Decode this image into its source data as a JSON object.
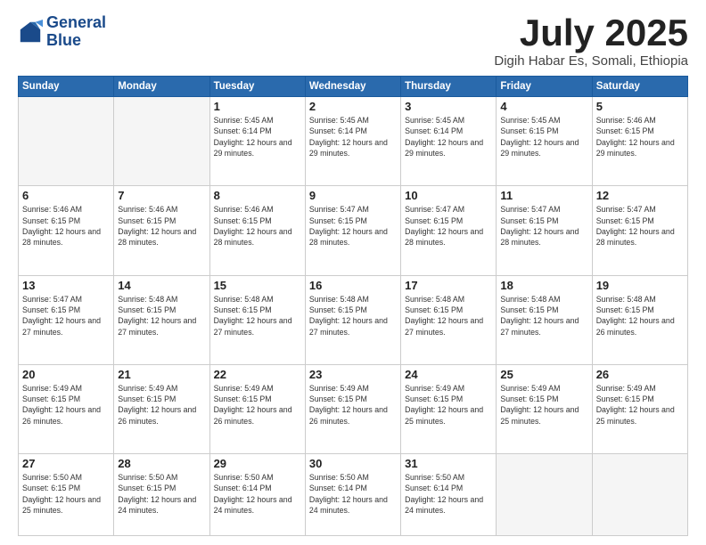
{
  "header": {
    "logo_line1": "General",
    "logo_line2": "Blue",
    "month_title": "July 2025",
    "subtitle": "Digih Habar Es, Somali, Ethiopia"
  },
  "weekdays": [
    "Sunday",
    "Monday",
    "Tuesday",
    "Wednesday",
    "Thursday",
    "Friday",
    "Saturday"
  ],
  "weeks": [
    [
      {
        "day": "",
        "info": ""
      },
      {
        "day": "",
        "info": ""
      },
      {
        "day": "1",
        "info": "Sunrise: 5:45 AM\nSunset: 6:14 PM\nDaylight: 12 hours and 29 minutes."
      },
      {
        "day": "2",
        "info": "Sunrise: 5:45 AM\nSunset: 6:14 PM\nDaylight: 12 hours and 29 minutes."
      },
      {
        "day": "3",
        "info": "Sunrise: 5:45 AM\nSunset: 6:14 PM\nDaylight: 12 hours and 29 minutes."
      },
      {
        "day": "4",
        "info": "Sunrise: 5:45 AM\nSunset: 6:15 PM\nDaylight: 12 hours and 29 minutes."
      },
      {
        "day": "5",
        "info": "Sunrise: 5:46 AM\nSunset: 6:15 PM\nDaylight: 12 hours and 29 minutes."
      }
    ],
    [
      {
        "day": "6",
        "info": "Sunrise: 5:46 AM\nSunset: 6:15 PM\nDaylight: 12 hours and 28 minutes."
      },
      {
        "day": "7",
        "info": "Sunrise: 5:46 AM\nSunset: 6:15 PM\nDaylight: 12 hours and 28 minutes."
      },
      {
        "day": "8",
        "info": "Sunrise: 5:46 AM\nSunset: 6:15 PM\nDaylight: 12 hours and 28 minutes."
      },
      {
        "day": "9",
        "info": "Sunrise: 5:47 AM\nSunset: 6:15 PM\nDaylight: 12 hours and 28 minutes."
      },
      {
        "day": "10",
        "info": "Sunrise: 5:47 AM\nSunset: 6:15 PM\nDaylight: 12 hours and 28 minutes."
      },
      {
        "day": "11",
        "info": "Sunrise: 5:47 AM\nSunset: 6:15 PM\nDaylight: 12 hours and 28 minutes."
      },
      {
        "day": "12",
        "info": "Sunrise: 5:47 AM\nSunset: 6:15 PM\nDaylight: 12 hours and 28 minutes."
      }
    ],
    [
      {
        "day": "13",
        "info": "Sunrise: 5:47 AM\nSunset: 6:15 PM\nDaylight: 12 hours and 27 minutes."
      },
      {
        "day": "14",
        "info": "Sunrise: 5:48 AM\nSunset: 6:15 PM\nDaylight: 12 hours and 27 minutes."
      },
      {
        "day": "15",
        "info": "Sunrise: 5:48 AM\nSunset: 6:15 PM\nDaylight: 12 hours and 27 minutes."
      },
      {
        "day": "16",
        "info": "Sunrise: 5:48 AM\nSunset: 6:15 PM\nDaylight: 12 hours and 27 minutes."
      },
      {
        "day": "17",
        "info": "Sunrise: 5:48 AM\nSunset: 6:15 PM\nDaylight: 12 hours and 27 minutes."
      },
      {
        "day": "18",
        "info": "Sunrise: 5:48 AM\nSunset: 6:15 PM\nDaylight: 12 hours and 27 minutes."
      },
      {
        "day": "19",
        "info": "Sunrise: 5:48 AM\nSunset: 6:15 PM\nDaylight: 12 hours and 26 minutes."
      }
    ],
    [
      {
        "day": "20",
        "info": "Sunrise: 5:49 AM\nSunset: 6:15 PM\nDaylight: 12 hours and 26 minutes."
      },
      {
        "day": "21",
        "info": "Sunrise: 5:49 AM\nSunset: 6:15 PM\nDaylight: 12 hours and 26 minutes."
      },
      {
        "day": "22",
        "info": "Sunrise: 5:49 AM\nSunset: 6:15 PM\nDaylight: 12 hours and 26 minutes."
      },
      {
        "day": "23",
        "info": "Sunrise: 5:49 AM\nSunset: 6:15 PM\nDaylight: 12 hours and 26 minutes."
      },
      {
        "day": "24",
        "info": "Sunrise: 5:49 AM\nSunset: 6:15 PM\nDaylight: 12 hours and 25 minutes."
      },
      {
        "day": "25",
        "info": "Sunrise: 5:49 AM\nSunset: 6:15 PM\nDaylight: 12 hours and 25 minutes."
      },
      {
        "day": "26",
        "info": "Sunrise: 5:49 AM\nSunset: 6:15 PM\nDaylight: 12 hours and 25 minutes."
      }
    ],
    [
      {
        "day": "27",
        "info": "Sunrise: 5:50 AM\nSunset: 6:15 PM\nDaylight: 12 hours and 25 minutes."
      },
      {
        "day": "28",
        "info": "Sunrise: 5:50 AM\nSunset: 6:15 PM\nDaylight: 12 hours and 24 minutes."
      },
      {
        "day": "29",
        "info": "Sunrise: 5:50 AM\nSunset: 6:14 PM\nDaylight: 12 hours and 24 minutes."
      },
      {
        "day": "30",
        "info": "Sunrise: 5:50 AM\nSunset: 6:14 PM\nDaylight: 12 hours and 24 minutes."
      },
      {
        "day": "31",
        "info": "Sunrise: 5:50 AM\nSunset: 6:14 PM\nDaylight: 12 hours and 24 minutes."
      },
      {
        "day": "",
        "info": ""
      },
      {
        "day": "",
        "info": ""
      }
    ]
  ]
}
